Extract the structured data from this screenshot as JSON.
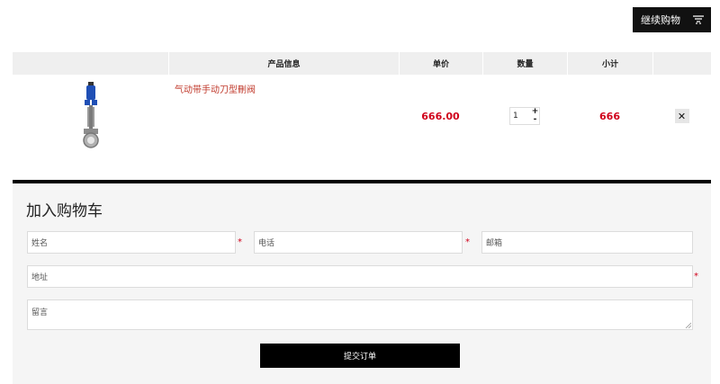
{
  "header": {
    "continue_shopping_label": "继续购物",
    "cart_icon": "cart-icon"
  },
  "table": {
    "headers": {
      "info": "产品信息",
      "price": "单价",
      "qty": "数量",
      "subtotal": "小计"
    },
    "rows": [
      {
        "name": "气动带手动刀型刪阀",
        "price": "666.00",
        "qty": "1",
        "qty_up": "+",
        "qty_down": "-",
        "subtotal": "666",
        "remove": "✕"
      }
    ]
  },
  "form": {
    "title": "加入购物车",
    "name_placeholder": "姓名",
    "phone_placeholder": "电话",
    "email_placeholder": "邮箱",
    "address_placeholder": "地址",
    "message_placeholder": "留言",
    "required_mark": "*",
    "submit_label": "提交订单"
  },
  "colors": {
    "accent_red": "#d0021b",
    "button_black": "#000000",
    "panel_bg": "#f5f5f5"
  }
}
